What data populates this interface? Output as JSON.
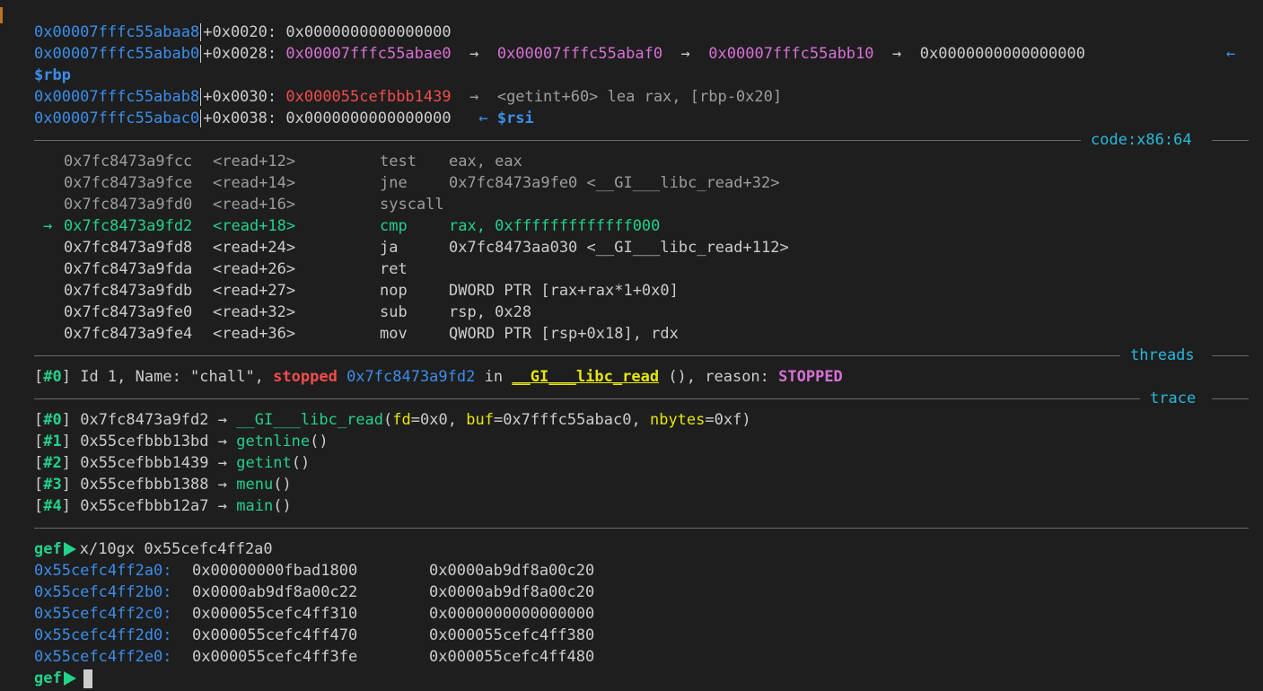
{
  "stack": [
    {
      "addr": "0x00007fffc55abaa8",
      "off": "+0x0020:",
      "val": "0x0000000000000000"
    },
    {
      "addr": "0x00007fffc55abab0",
      "off": "+0x0028:",
      "chain": [
        "0x00007fffc55abae0",
        "0x00007fffc55abaf0",
        "0x00007fffc55abb10"
      ],
      "end": "0x0000000000000000",
      "tag": "$rbp"
    },
    {
      "addr": "0x00007fffc55abab8",
      "off": "+0x0030:",
      "val": "0x000055cefbbb1439",
      "sym": "<getint+60> lea rax, [rbp-0x20]"
    },
    {
      "addr": "0x00007fffc55abac0",
      "off": "+0x0038:",
      "val": "0x0000000000000000",
      "tag": "$rsi"
    }
  ],
  "arrow_glyph": "→",
  "left_arrow": "←",
  "sections": {
    "code": "code:x86:64",
    "threads": "threads",
    "trace": "trace"
  },
  "code": [
    {
      "addr": "0x7fc8473a9fcc",
      "sym": "<read+12>",
      "op": "test",
      "args": "eax, eax",
      "state": "past"
    },
    {
      "addr": "0x7fc8473a9fce",
      "sym": "<read+14>",
      "op": "jne",
      "args": "0x7fc8473a9fe0 <__GI___libc_read+32>",
      "state": "past"
    },
    {
      "addr": "0x7fc8473a9fd0",
      "sym": "<read+16>",
      "op": "syscall",
      "args": "",
      "state": "past"
    },
    {
      "addr": "0x7fc8473a9fd2",
      "sym": "<read+18>",
      "op": "cmp",
      "args": "rax, 0xfffffffffffff000",
      "state": "current"
    },
    {
      "addr": "0x7fc8473a9fd8",
      "sym": "<read+24>",
      "op": "ja",
      "args": "0x7fc8473aa030 <__GI___libc_read+112>",
      "state": "next"
    },
    {
      "addr": "0x7fc8473a9fda",
      "sym": "<read+26>",
      "op": "ret",
      "args": "",
      "state": "next"
    },
    {
      "addr": "0x7fc8473a9fdb",
      "sym": "<read+27>",
      "op": "nop",
      "args": "DWORD PTR [rax+rax*1+0x0]",
      "state": "next"
    },
    {
      "addr": "0x7fc8473a9fe0",
      "sym": "<read+32>",
      "op": "sub",
      "args": "rsp, 0x28",
      "state": "next"
    },
    {
      "addr": "0x7fc8473a9fe4",
      "sym": "<read+36>",
      "op": "mov",
      "args": "QWORD PTR [rsp+0x18], rdx",
      "state": "next"
    }
  ],
  "thread": {
    "idx": "#0",
    "desc": " Id 1, Name: \"chall\", ",
    "status": "stopped",
    "pc": "0x7fc8473a9fd2",
    "in": " in ",
    "func": "__GI___libc_read",
    "tail": " (), reason: ",
    "reason": "STOPPED"
  },
  "trace": [
    {
      "idx": "#0",
      "addr": "0x7fc8473a9fd2",
      "func": "__GI___libc_read",
      "args": [
        {
          "k": "fd",
          "v": "0x0"
        },
        {
          "k": "buf",
          "v": "0x7fffc55abac0"
        },
        {
          "k": "nbytes",
          "v": "0xf"
        }
      ]
    },
    {
      "idx": "#1",
      "addr": "0x55cefbbb13bd",
      "func": "getnline",
      "args": []
    },
    {
      "idx": "#2",
      "addr": "0x55cefbbb1439",
      "func": "getint",
      "args": []
    },
    {
      "idx": "#3",
      "addr": "0x55cefbbb1388",
      "func": "menu",
      "args": []
    },
    {
      "idx": "#4",
      "addr": "0x55cefbbb12a7",
      "func": "main",
      "args": []
    }
  ],
  "prompt": "gef",
  "command": "x/10gx 0x55cefc4ff2a0",
  "memory": [
    {
      "addr": "0x55cefc4ff2a0:",
      "v1": "0x00000000fbad1800",
      "v2": "0x0000ab9df8a00c20"
    },
    {
      "addr": "0x55cefc4ff2b0:",
      "v1": "0x0000ab9df8a00c22",
      "v2": "0x0000ab9df8a00c20"
    },
    {
      "addr": "0x55cefc4ff2c0:",
      "v1": "0x000055cefc4ff310",
      "v2": "0x0000000000000000"
    },
    {
      "addr": "0x55cefc4ff2d0:",
      "v1": "0x000055cefc4ff470",
      "v2": "0x000055cefc4ff380"
    },
    {
      "addr": "0x55cefc4ff2e0:",
      "v1": "0x000055cefc4ff3fe",
      "v2": "0x000055cefc4ff480"
    }
  ]
}
